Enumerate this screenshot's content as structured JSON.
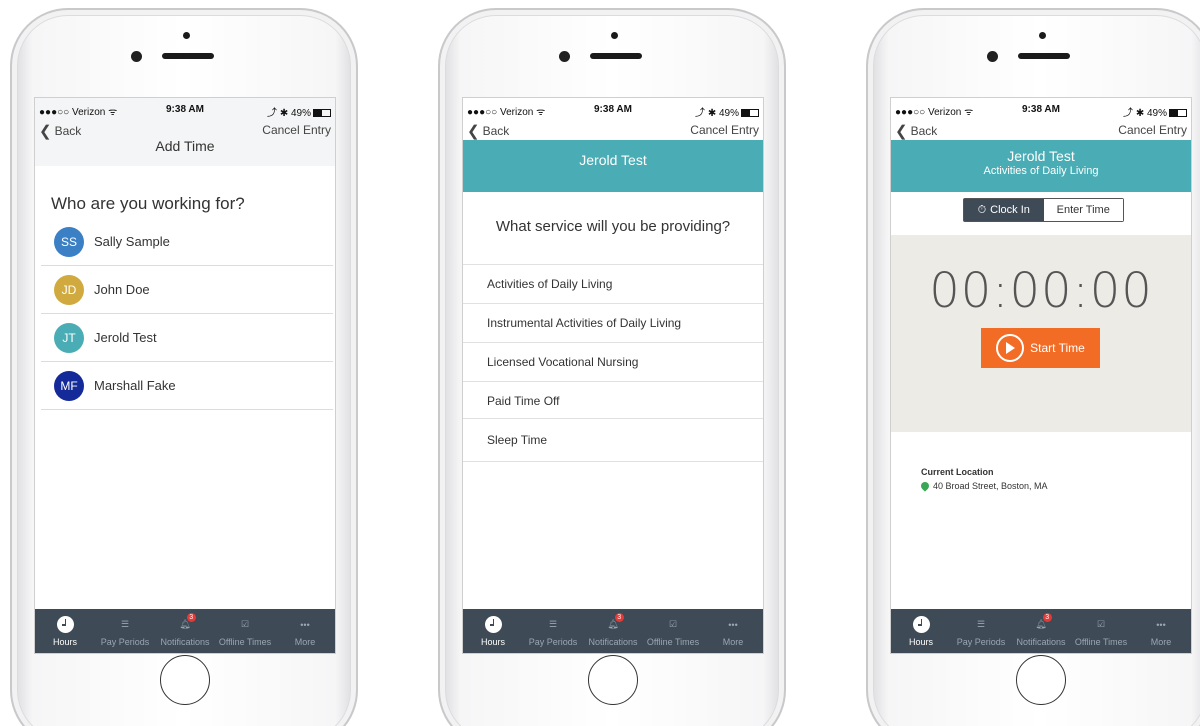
{
  "status": {
    "carrier": "●●●○○ Verizon ᯤ",
    "time": "9:38 AM",
    "battery": "⤴ ✱ 49%"
  },
  "nav": {
    "back_label": "Back",
    "cancel_label": "Cancel Entry"
  },
  "screen1": {
    "title": "Add Time",
    "question": "Who are you working for?",
    "people": [
      {
        "initials": "SS",
        "name": "Sally Sample",
        "color": "#3b7fc4"
      },
      {
        "initials": "JD",
        "name": "John Doe",
        "color": "#d1aa3f"
      },
      {
        "initials": "JT",
        "name": "Jerold Test",
        "color": "#4aadb5"
      },
      {
        "initials": "MF",
        "name": "Marshall Fake",
        "color": "#142a99"
      }
    ]
  },
  "screen2": {
    "header": "Jerold Test",
    "question": "What service will you be providing?",
    "services": [
      "Activities of Daily Living",
      "Instrumental Activities of Daily Living",
      "Licensed Vocational Nursing",
      "Paid Time Off",
      "Sleep Time"
    ]
  },
  "screen3": {
    "header": "Jerold Test",
    "subheader": "Activities of Daily Living",
    "seg_clock": "Clock In",
    "seg_enter": "Enter Time",
    "timer": "00:00:00",
    "start_label": "Start Time",
    "location_title": "Current Location",
    "location_address": "40 Broad Street, Boston, MA"
  },
  "tabs": [
    "Hours",
    "Pay Periods",
    "Notifications",
    "Offline Times",
    "More"
  ],
  "notification_count": "3",
  "colors": {
    "teal": "#4aadb5",
    "tabbar": "#3e4a56",
    "orange": "#f26c26"
  }
}
